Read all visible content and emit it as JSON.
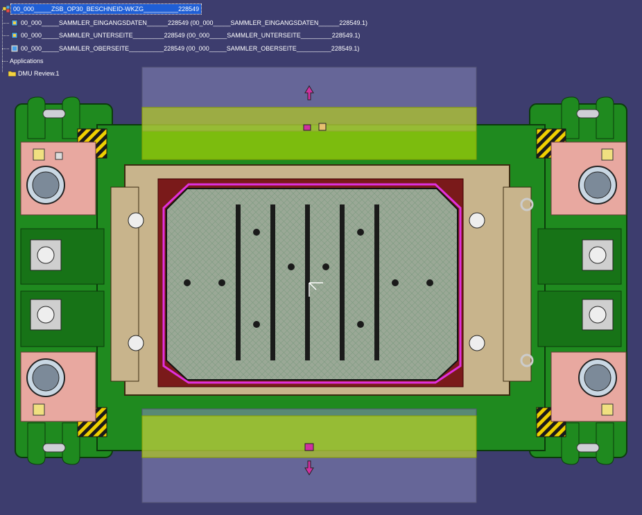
{
  "tree": {
    "root": {
      "label": "00_000_____ZSB_OP30_BESCHNEID-WKZG__________228549"
    },
    "children": [
      {
        "label": "00_000_____SAMMLER_EINGANGSDATEN______228549 (00_000_____SAMMLER_EINGANGSDATEN______228549.1)"
      },
      {
        "label": "00_000_____SAMMLER_UNTERSEITE_________228549 (00_000_____SAMMLER_UNTERSEITE_________228549.1)"
      },
      {
        "label": "00_000_____SAMMLER_OBERSEITE__________228549 (00_000_____SAMMLER_OBERSEITE__________228549.1)"
      }
    ],
    "applications": {
      "label": "Applications"
    },
    "dmu_review": {
      "label": "DMU Review.1"
    }
  },
  "colors": {
    "background": "#3d3d6e",
    "die_green": "#1f8a1f",
    "pink_pad": "#e8a8a0",
    "tan_frame": "#c8b48c",
    "yellow_overlay": "#c8e600",
    "highlight_magenta": "#e030e0",
    "hazard_yellow": "#f0d000"
  },
  "icons": {
    "product": "assembly-icon",
    "part": "component-icon",
    "folder": "folder-icon"
  }
}
